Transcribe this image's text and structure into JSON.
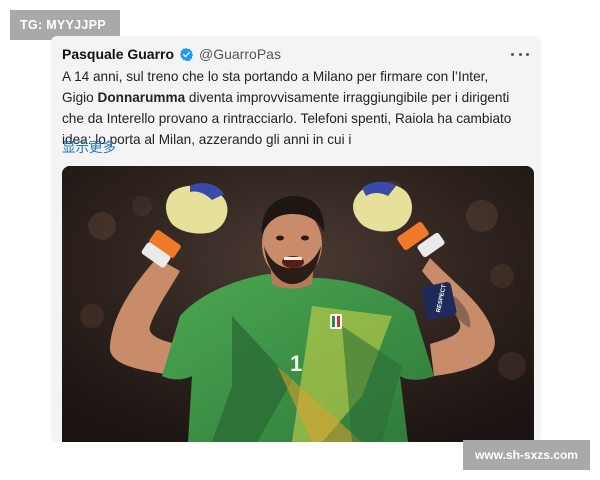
{
  "watermark_top": "TG: MYYJJPP",
  "watermark_bottom": "www.sh-sxzs.com",
  "tweet": {
    "author_name": "Pasquale Guarro",
    "handle": "@GuarroPas",
    "text_lines": [
      "A 14 anni, sul treno che lo sta portando a Milano per firmare con l’Inter,",
      "diventa improvvisamente irraggiungibile per i dirigenti",
      "che da Interello provano a rintracciarlo. Telefoni spenti, Raiola ha cambiato",
      "idea: lo porta al Milan, azzerando gli anni in cui i"
    ],
    "line2_prefix": "Gigio ",
    "line2_bold": "Donnarumma",
    "show_more": "显示更多",
    "verified_icon": "verified-badge-icon",
    "more_icon": "more-dots-icon"
  },
  "image": {
    "description_icon": "goalkeeper-celebrating-photo",
    "armband_text": "RESPECT",
    "colors": {
      "jersey": "#3f9a47",
      "jersey_dark": "#2f7a3a",
      "accent_yellow": "#d6d94a",
      "glove": "#e7e09a",
      "glove_band": "#f07a2a",
      "background": "#241a17"
    }
  },
  "colors": {
    "link": "#1d76c2",
    "verified": "#1d9bf0",
    "badge_bg": "#a9a9a9"
  }
}
